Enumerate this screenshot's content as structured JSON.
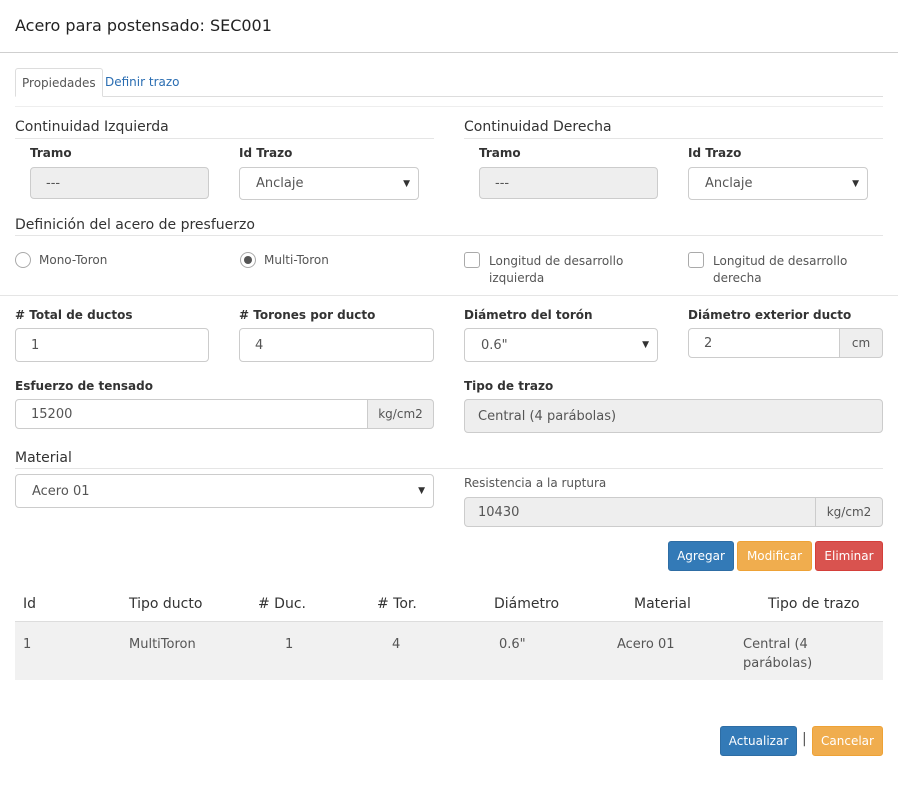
{
  "dialog": {
    "title": "Acero para postensado: SEC001"
  },
  "tabs": [
    {
      "label": "Propiedades",
      "active": true
    },
    {
      "label": "Definir trazo",
      "active": false
    }
  ],
  "continuity_left": {
    "heading": "Continuidad Izquierda",
    "tramo_label": "Tramo",
    "tramo_value": "---",
    "idtrazo_label": "Id Trazo",
    "idtrazo_value": "Anclaje"
  },
  "continuity_right": {
    "heading": "Continuidad Derecha",
    "tramo_label": "Tramo",
    "tramo_value": "---",
    "idtrazo_label": "Id Trazo",
    "idtrazo_value": "Anclaje"
  },
  "prestress": {
    "heading": "Definición del acero de presfuerzo",
    "mono_label": "Mono-Toron",
    "multi_label": "Multi-Toron",
    "selected": "multi",
    "dev_left_label_1": "Longitud de desarrollo",
    "dev_left_label_2": "izquierda",
    "dev_right_label_1": "Longitud de desarrollo",
    "dev_right_label_2": "derecha"
  },
  "fields": {
    "total_ductos_label": "# Total de ductos",
    "total_ductos_value": "1",
    "torones_label": "# Torones por ducto",
    "torones_value": "4",
    "diam_toron_label": "Diámetro del torón",
    "diam_toron_value": "0.6\"",
    "diam_ext_label": "Diámetro exterior ducto",
    "diam_ext_value": "2",
    "diam_ext_unit": "cm",
    "esfuerzo_label": "Esfuerzo de tensado",
    "esfuerzo_value": "15200",
    "esfuerzo_unit": "kg/cm2",
    "tipo_trazo_label": "Tipo de trazo",
    "tipo_trazo_value": "Central (4 parábolas)"
  },
  "material": {
    "heading": "Material",
    "value": "Acero 01",
    "resistencia_label": "Resistencia a la ruptura",
    "resistencia_value": "10430",
    "resistencia_unit": "kg/cm2"
  },
  "actions": {
    "add": "Agregar",
    "modify": "Modificar",
    "delete": "Eliminar"
  },
  "table": {
    "headers": [
      "Id",
      "Tipo ducto",
      "# Duc.",
      "# Tor.",
      "Diámetro",
      "Material",
      "Tipo de trazo"
    ],
    "rows": [
      {
        "id": "1",
        "tipo": "MultiToron",
        "duc": "1",
        "tor": "4",
        "diam": "0.6\"",
        "material": "Acero 01",
        "trazo_1": "Central (4",
        "trazo_2": "parábolas)"
      }
    ]
  },
  "footer": {
    "update": "Actualizar",
    "separator": "|",
    "cancel": "Cancelar"
  },
  "colors": {
    "primary": "#337ab7",
    "warning": "#f0ad4e",
    "danger": "#d9534f",
    "readonly": "#eeeeee"
  }
}
